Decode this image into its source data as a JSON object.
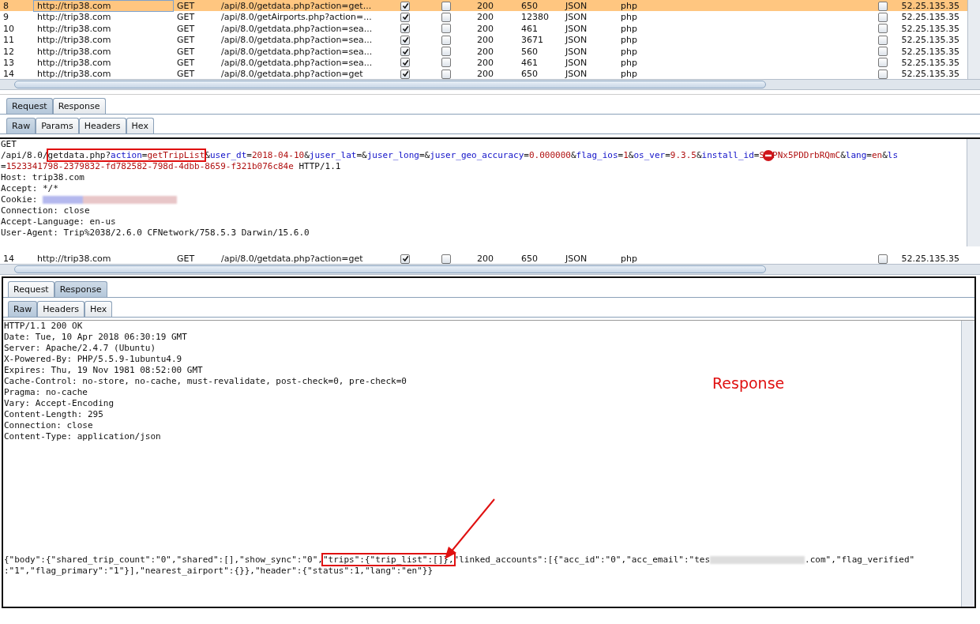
{
  "history_table": {
    "rows": [
      {
        "number": "8",
        "host": "http://trip38.com",
        "method": "GET",
        "url": "/api/8.0/getdata.php?action=get...",
        "params": true,
        "edited": false,
        "status": "200",
        "length": "650",
        "mime": "JSON",
        "extension": "php",
        "flag": false,
        "ip": "52.25.135.35",
        "selected": true
      },
      {
        "number": "9",
        "host": "http://trip38.com",
        "method": "GET",
        "url": "/api/8.0/getAirports.php?action=...",
        "params": true,
        "edited": false,
        "status": "200",
        "length": "12380",
        "mime": "JSON",
        "extension": "php",
        "flag": false,
        "ip": "52.25.135.35",
        "selected": false
      },
      {
        "number": "10",
        "host": "http://trip38.com",
        "method": "GET",
        "url": "/api/8.0/getdata.php?action=sea...",
        "params": true,
        "edited": false,
        "status": "200",
        "length": "461",
        "mime": "JSON",
        "extension": "php",
        "flag": false,
        "ip": "52.25.135.35",
        "selected": false
      },
      {
        "number": "11",
        "host": "http://trip38.com",
        "method": "GET",
        "url": "/api/8.0/getdata.php?action=sea...",
        "params": true,
        "edited": false,
        "status": "200",
        "length": "3671",
        "mime": "JSON",
        "extension": "php",
        "flag": false,
        "ip": "52.25.135.35",
        "selected": false
      },
      {
        "number": "12",
        "host": "http://trip38.com",
        "method": "GET",
        "url": "/api/8.0/getdata.php?action=sea...",
        "params": true,
        "edited": false,
        "status": "200",
        "length": "560",
        "mime": "JSON",
        "extension": "php",
        "flag": false,
        "ip": "52.25.135.35",
        "selected": false
      },
      {
        "number": "13",
        "host": "http://trip38.com",
        "method": "GET",
        "url": "/api/8.0/getdata.php?action=sea...",
        "params": true,
        "edited": false,
        "status": "200",
        "length": "461",
        "mime": "JSON",
        "extension": "php",
        "flag": false,
        "ip": "52.25.135.35",
        "selected": false
      },
      {
        "number": "14",
        "host": "http://trip38.com",
        "method": "GET",
        "url": "/api/8.0/getdata.php?action=get",
        "params": true,
        "edited": false,
        "status": "200",
        "length": "650",
        "mime": "JSON",
        "extension": "php",
        "flag": false,
        "ip": "52.25.135.35",
        "selected": false
      }
    ]
  },
  "request_panel": {
    "tabs": [
      {
        "label": "Request",
        "selected": true
      },
      {
        "label": "Response",
        "selected": false
      }
    ],
    "view_tabs": [
      {
        "label": "Raw",
        "selected": true
      },
      {
        "label": "Params",
        "selected": false
      },
      {
        "label": "Headers",
        "selected": false
      },
      {
        "label": "Hex",
        "selected": false
      }
    ],
    "lines": [
      {
        "segments": [
          {
            "kind": "plain",
            "text": "GET"
          }
        ]
      },
      {
        "segments": [
          {
            "kind": "plain",
            "text": "/api/8.0/"
          },
          {
            "kind": "box",
            "segments": [
              {
                "kind": "plain",
                "text": "getdata.php?"
              },
              {
                "kind": "name",
                "text": "action"
              },
              {
                "kind": "plain",
                "text": "="
              },
              {
                "kind": "value",
                "text": "getTripList"
              }
            ]
          },
          {
            "kind": "plain",
            "text": "&"
          },
          {
            "kind": "name",
            "text": "user_dt"
          },
          {
            "kind": "plain",
            "text": "="
          },
          {
            "kind": "value",
            "text": "2018-04-10"
          },
          {
            "kind": "plain",
            "text": "&"
          },
          {
            "kind": "name",
            "text": "juser_lat"
          },
          {
            "kind": "plain",
            "text": "=&"
          },
          {
            "kind": "name",
            "text": "juser_long"
          },
          {
            "kind": "plain",
            "text": "=&"
          },
          {
            "kind": "name",
            "text": "juser_geo_accuracy"
          },
          {
            "kind": "plain",
            "text": "="
          },
          {
            "kind": "value",
            "text": "0.000000"
          },
          {
            "kind": "plain",
            "text": "&"
          },
          {
            "kind": "name",
            "text": "flag_ios"
          },
          {
            "kind": "plain",
            "text": "="
          },
          {
            "kind": "value",
            "text": "1"
          },
          {
            "kind": "plain",
            "text": "&"
          },
          {
            "kind": "name",
            "text": "os_ver"
          },
          {
            "kind": "plain",
            "text": "="
          },
          {
            "kind": "value",
            "text": "9.3.5"
          },
          {
            "kind": "plain",
            "text": "&"
          },
          {
            "kind": "name",
            "text": "install_id"
          },
          {
            "kind": "plain",
            "text": "="
          },
          {
            "kind": "value",
            "text": "S"
          },
          {
            "kind": "blocked"
          },
          {
            "kind": "value",
            "text": "PNx5PDDrbRQmC"
          },
          {
            "kind": "plain",
            "text": "&"
          },
          {
            "kind": "name",
            "text": "lang"
          },
          {
            "kind": "plain",
            "text": "="
          },
          {
            "kind": "value",
            "text": "en"
          },
          {
            "kind": "plain",
            "text": "&"
          },
          {
            "kind": "name",
            "text": "ls"
          }
        ]
      },
      {
        "segments": [
          {
            "kind": "plain",
            "text": "="
          },
          {
            "kind": "value",
            "text": "1523341798-2379832-fd782582-798d-4dbb-8659-f321b076c84e"
          },
          {
            "kind": "plain",
            "text": " HTTP/1.1"
          }
        ]
      },
      {
        "segments": [
          {
            "kind": "plain",
            "text": "Host: trip38.com"
          }
        ]
      },
      {
        "segments": [
          {
            "kind": "plain",
            "text": "Accept: */*"
          }
        ]
      },
      {
        "segments": [
          {
            "kind": "plain",
            "text": "Cookie: "
          },
          {
            "kind": "redacted"
          }
        ]
      },
      {
        "segments": [
          {
            "kind": "plain",
            "text": "Connection: close"
          }
        ]
      },
      {
        "segments": [
          {
            "kind": "plain",
            "text": "Accept-Language: en-us"
          }
        ]
      },
      {
        "segments": [
          {
            "kind": "plain",
            "text": "User-Agent: Trip%2038/2.6.0 CFNetwork/758.5.3 Darwin/15.6.0"
          }
        ]
      }
    ]
  },
  "history_table_2": {
    "rows": [
      {
        "number": "14",
        "host": "http://trip38.com",
        "method": "GET",
        "url": "/api/8.0/getdata.php?action=get",
        "params": true,
        "edited": false,
        "status": "200",
        "length": "650",
        "mime": "JSON",
        "extension": "php",
        "flag": false,
        "ip": "52.25.135.35",
        "selected": false
      }
    ]
  },
  "response_panel": {
    "tabs": [
      {
        "label": "Request",
        "selected": false
      },
      {
        "label": "Response",
        "selected": true
      }
    ],
    "view_tabs": [
      {
        "label": "Raw",
        "selected": true
      },
      {
        "label": "Headers",
        "selected": false
      },
      {
        "label": "Hex",
        "selected": false
      }
    ],
    "header_lines": [
      "HTTP/1.1 200 OK",
      "Date: Tue, 10 Apr 2018 06:30:19 GMT",
      "Server: Apache/2.4.7 (Ubuntu)",
      "X-Powered-By: PHP/5.5.9-1ubuntu4.9",
      "Expires: Thu, 19 Nov 1981 08:52:00 GMT",
      "Cache-Control: no-store, no-cache, must-revalidate, post-check=0, pre-check=0",
      "Pragma: no-cache",
      "Vary: Accept-Encoding",
      "Content-Length: 295",
      "Connection: close",
      "Content-Type: application/json"
    ],
    "body_lines": [
      {
        "segments": [
          {
            "kind": "plain",
            "text": "{\"body\":{\"shared_trip_count\":\"0\",\"shared\":[],\"show_sync\":\"0\","
          },
          {
            "kind": "box",
            "segments": [
              {
                "kind": "plain",
                "text": "\"trips\":{\"trip_list\":[]},"
              }
            ]
          },
          {
            "kind": "plain",
            "text": "\"linked_accounts\":[{\"acc_id\":\"0\",\"acc_email\":\"tes"
          },
          {
            "kind": "redacted"
          },
          {
            "kind": "plain",
            "text": ".com\",\"flag_verified\""
          }
        ]
      },
      {
        "segments": [
          {
            "kind": "plain",
            "text": ":\"1\",\"flag_primary\":\"1\"}],\"nearest_airport\":{}},\"header\":{\"status\":1,\"lang\":\"en\"}}"
          }
        ]
      }
    ],
    "annotation": "Response"
  }
}
